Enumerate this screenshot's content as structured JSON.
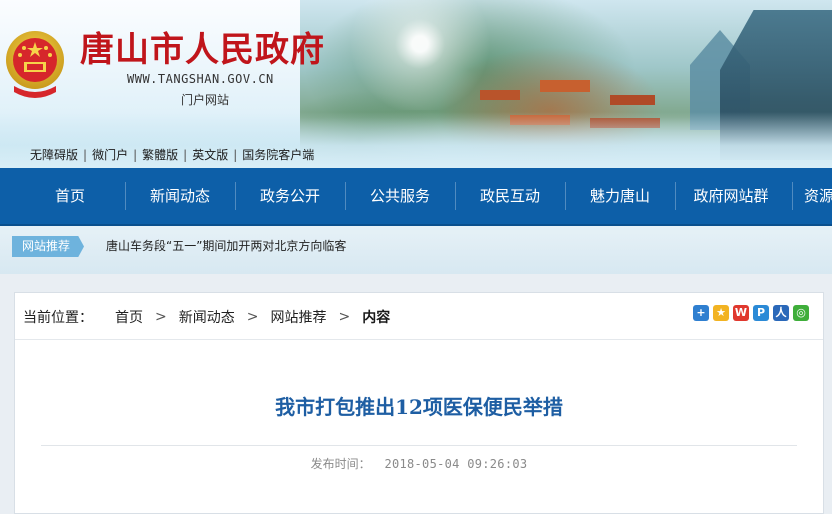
{
  "header": {
    "title": "唐山市人民政府",
    "url": "WWW.TANGSHAN.GOV.CN",
    "subtitle": "门户网站",
    "quick_links": [
      "无障碍版",
      "微门户",
      "繁體版",
      "英文版",
      "国务院客户端"
    ]
  },
  "nav": {
    "items": [
      "首页",
      "新闻动态",
      "政务公开",
      "公共服务",
      "政民互动",
      "魅力唐山",
      "政府网站群",
      "资源"
    ]
  },
  "ticker": {
    "tag": "网站推荐",
    "headline": "唐山车务段“五一”期间加开两对北京方向临客"
  },
  "breadcrumb": {
    "label": "当前位置：",
    "items": [
      "首页",
      "新闻动态",
      "网站推荐",
      "内容"
    ]
  },
  "article": {
    "title": "我市打包推出12项医保便民举措",
    "publish_label": "发布时间：",
    "publish_time": "2018-05-04 09:26:03"
  },
  "share_icons": [
    "add-share",
    "qzone",
    "weibo",
    "tencent-weibo",
    "renren",
    "wechat"
  ],
  "colors": {
    "nav_bg": "#0d5fa8",
    "title_red": "#c0151b",
    "article_title": "#1e5ea3",
    "tag_bg": "#6eb3dd"
  }
}
